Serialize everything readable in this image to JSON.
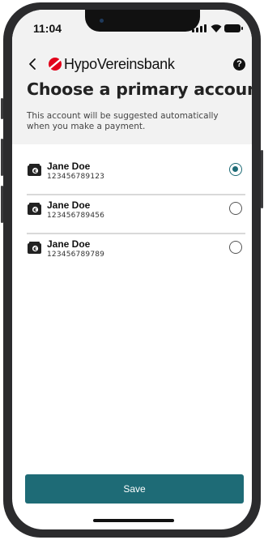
{
  "status": {
    "time": "11:04"
  },
  "header": {
    "brand": "HypoVereinsbank",
    "title": "Choose a primary account",
    "subtitle": "This account will be suggested automatically when you make a payment.",
    "help_label": "?"
  },
  "accounts": [
    {
      "name": "Jane Doe",
      "number": "123456789123",
      "selected": true
    },
    {
      "name": "Jane Doe",
      "number": "123456789456",
      "selected": false
    },
    {
      "name": "Jane Doe",
      "number": "123456789789",
      "selected": false
    }
  ],
  "actions": {
    "save_label": "Save"
  },
  "colors": {
    "primary": "#1e6b76",
    "brand_red": "#e2001a",
    "header_bg": "#f2f2f2"
  }
}
